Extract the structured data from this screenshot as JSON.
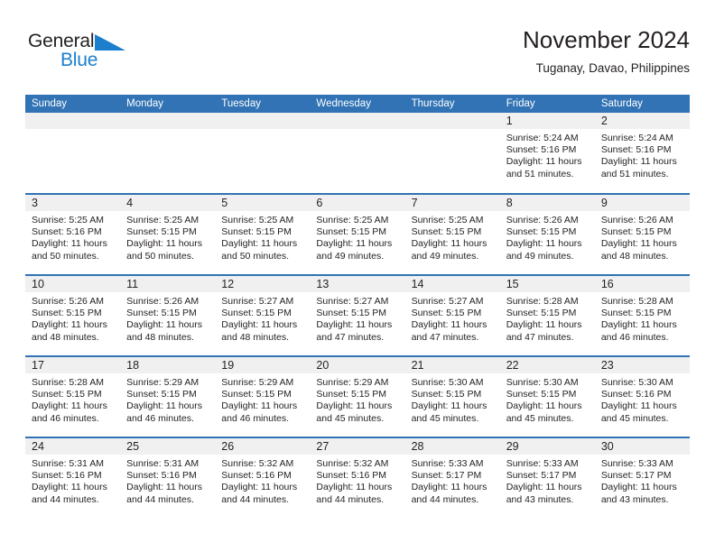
{
  "brand": {
    "name_part1": "General",
    "name_part2": "Blue",
    "triangle_color": "#1b7fce"
  },
  "header": {
    "title": "November 2024",
    "subtitle": "Tuganay, Davao, Philippines"
  },
  "colors": {
    "header_blue": "#3173b4",
    "daynum_band": "#f0f0f0",
    "text": "#231f20",
    "brand_blue": "#1b7fce"
  },
  "weekdays": [
    "Sunday",
    "Monday",
    "Tuesday",
    "Wednesday",
    "Thursday",
    "Friday",
    "Saturday"
  ],
  "labels": {
    "sunrise_prefix": "Sunrise:",
    "sunset_prefix": "Sunset:",
    "daylight_prefix": "Daylight:"
  },
  "weeks": [
    [
      {
        "day": "",
        "empty": true
      },
      {
        "day": "",
        "empty": true
      },
      {
        "day": "",
        "empty": true
      },
      {
        "day": "",
        "empty": true
      },
      {
        "day": "",
        "empty": true
      },
      {
        "day": "1",
        "sunrise": "Sunrise: 5:24 AM",
        "sunset": "Sunset: 5:16 PM",
        "daylight_l1": "Daylight: 11 hours",
        "daylight_l2": "and 51 minutes."
      },
      {
        "day": "2",
        "sunrise": "Sunrise: 5:24 AM",
        "sunset": "Sunset: 5:16 PM",
        "daylight_l1": "Daylight: 11 hours",
        "daylight_l2": "and 51 minutes."
      }
    ],
    [
      {
        "day": "3",
        "sunrise": "Sunrise: 5:25 AM",
        "sunset": "Sunset: 5:16 PM",
        "daylight_l1": "Daylight: 11 hours",
        "daylight_l2": "and 50 minutes."
      },
      {
        "day": "4",
        "sunrise": "Sunrise: 5:25 AM",
        "sunset": "Sunset: 5:15 PM",
        "daylight_l1": "Daylight: 11 hours",
        "daylight_l2": "and 50 minutes."
      },
      {
        "day": "5",
        "sunrise": "Sunrise: 5:25 AM",
        "sunset": "Sunset: 5:15 PM",
        "daylight_l1": "Daylight: 11 hours",
        "daylight_l2": "and 50 minutes."
      },
      {
        "day": "6",
        "sunrise": "Sunrise: 5:25 AM",
        "sunset": "Sunset: 5:15 PM",
        "daylight_l1": "Daylight: 11 hours",
        "daylight_l2": "and 49 minutes."
      },
      {
        "day": "7",
        "sunrise": "Sunrise: 5:25 AM",
        "sunset": "Sunset: 5:15 PM",
        "daylight_l1": "Daylight: 11 hours",
        "daylight_l2": "and 49 minutes."
      },
      {
        "day": "8",
        "sunrise": "Sunrise: 5:26 AM",
        "sunset": "Sunset: 5:15 PM",
        "daylight_l1": "Daylight: 11 hours",
        "daylight_l2": "and 49 minutes."
      },
      {
        "day": "9",
        "sunrise": "Sunrise: 5:26 AM",
        "sunset": "Sunset: 5:15 PM",
        "daylight_l1": "Daylight: 11 hours",
        "daylight_l2": "and 48 minutes."
      }
    ],
    [
      {
        "day": "10",
        "sunrise": "Sunrise: 5:26 AM",
        "sunset": "Sunset: 5:15 PM",
        "daylight_l1": "Daylight: 11 hours",
        "daylight_l2": "and 48 minutes."
      },
      {
        "day": "11",
        "sunrise": "Sunrise: 5:26 AM",
        "sunset": "Sunset: 5:15 PM",
        "daylight_l1": "Daylight: 11 hours",
        "daylight_l2": "and 48 minutes."
      },
      {
        "day": "12",
        "sunrise": "Sunrise: 5:27 AM",
        "sunset": "Sunset: 5:15 PM",
        "daylight_l1": "Daylight: 11 hours",
        "daylight_l2": "and 48 minutes."
      },
      {
        "day": "13",
        "sunrise": "Sunrise: 5:27 AM",
        "sunset": "Sunset: 5:15 PM",
        "daylight_l1": "Daylight: 11 hours",
        "daylight_l2": "and 47 minutes."
      },
      {
        "day": "14",
        "sunrise": "Sunrise: 5:27 AM",
        "sunset": "Sunset: 5:15 PM",
        "daylight_l1": "Daylight: 11 hours",
        "daylight_l2": "and 47 minutes."
      },
      {
        "day": "15",
        "sunrise": "Sunrise: 5:28 AM",
        "sunset": "Sunset: 5:15 PM",
        "daylight_l1": "Daylight: 11 hours",
        "daylight_l2": "and 47 minutes."
      },
      {
        "day": "16",
        "sunrise": "Sunrise: 5:28 AM",
        "sunset": "Sunset: 5:15 PM",
        "daylight_l1": "Daylight: 11 hours",
        "daylight_l2": "and 46 minutes."
      }
    ],
    [
      {
        "day": "17",
        "sunrise": "Sunrise: 5:28 AM",
        "sunset": "Sunset: 5:15 PM",
        "daylight_l1": "Daylight: 11 hours",
        "daylight_l2": "and 46 minutes."
      },
      {
        "day": "18",
        "sunrise": "Sunrise: 5:29 AM",
        "sunset": "Sunset: 5:15 PM",
        "daylight_l1": "Daylight: 11 hours",
        "daylight_l2": "and 46 minutes."
      },
      {
        "day": "19",
        "sunrise": "Sunrise: 5:29 AM",
        "sunset": "Sunset: 5:15 PM",
        "daylight_l1": "Daylight: 11 hours",
        "daylight_l2": "and 46 minutes."
      },
      {
        "day": "20",
        "sunrise": "Sunrise: 5:29 AM",
        "sunset": "Sunset: 5:15 PM",
        "daylight_l1": "Daylight: 11 hours",
        "daylight_l2": "and 45 minutes."
      },
      {
        "day": "21",
        "sunrise": "Sunrise: 5:30 AM",
        "sunset": "Sunset: 5:15 PM",
        "daylight_l1": "Daylight: 11 hours",
        "daylight_l2": "and 45 minutes."
      },
      {
        "day": "22",
        "sunrise": "Sunrise: 5:30 AM",
        "sunset": "Sunset: 5:15 PM",
        "daylight_l1": "Daylight: 11 hours",
        "daylight_l2": "and 45 minutes."
      },
      {
        "day": "23",
        "sunrise": "Sunrise: 5:30 AM",
        "sunset": "Sunset: 5:16 PM",
        "daylight_l1": "Daylight: 11 hours",
        "daylight_l2": "and 45 minutes."
      }
    ],
    [
      {
        "day": "24",
        "sunrise": "Sunrise: 5:31 AM",
        "sunset": "Sunset: 5:16 PM",
        "daylight_l1": "Daylight: 11 hours",
        "daylight_l2": "and 44 minutes."
      },
      {
        "day": "25",
        "sunrise": "Sunrise: 5:31 AM",
        "sunset": "Sunset: 5:16 PM",
        "daylight_l1": "Daylight: 11 hours",
        "daylight_l2": "and 44 minutes."
      },
      {
        "day": "26",
        "sunrise": "Sunrise: 5:32 AM",
        "sunset": "Sunset: 5:16 PM",
        "daylight_l1": "Daylight: 11 hours",
        "daylight_l2": "and 44 minutes."
      },
      {
        "day": "27",
        "sunrise": "Sunrise: 5:32 AM",
        "sunset": "Sunset: 5:16 PM",
        "daylight_l1": "Daylight: 11 hours",
        "daylight_l2": "and 44 minutes."
      },
      {
        "day": "28",
        "sunrise": "Sunrise: 5:33 AM",
        "sunset": "Sunset: 5:17 PM",
        "daylight_l1": "Daylight: 11 hours",
        "daylight_l2": "and 44 minutes."
      },
      {
        "day": "29",
        "sunrise": "Sunrise: 5:33 AM",
        "sunset": "Sunset: 5:17 PM",
        "daylight_l1": "Daylight: 11 hours",
        "daylight_l2": "and 43 minutes."
      },
      {
        "day": "30",
        "sunrise": "Sunrise: 5:33 AM",
        "sunset": "Sunset: 5:17 PM",
        "daylight_l1": "Daylight: 11 hours",
        "daylight_l2": "and 43 minutes."
      }
    ]
  ]
}
